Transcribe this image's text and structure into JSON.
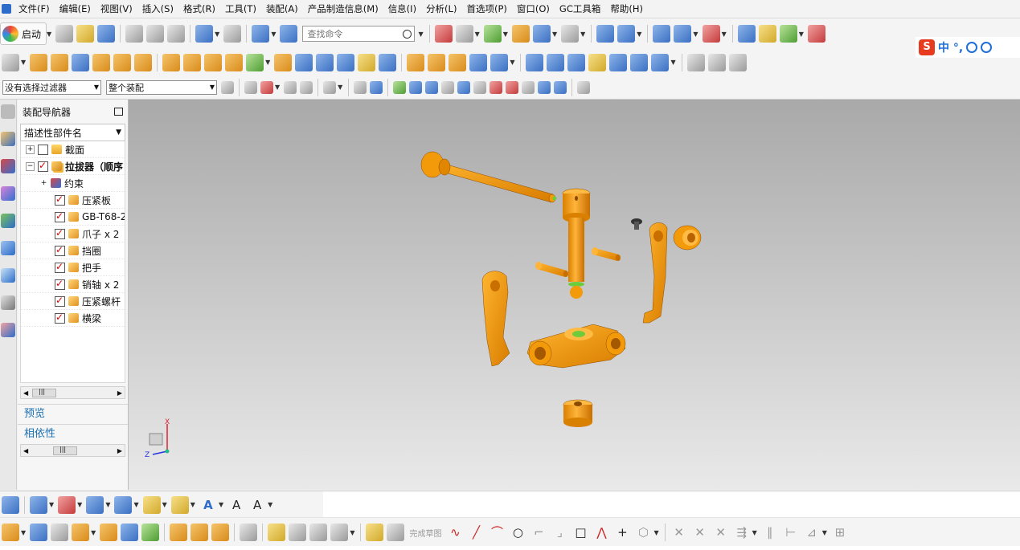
{
  "menubar": {
    "items": [
      "文件(F)",
      "编辑(E)",
      "视图(V)",
      "插入(S)",
      "格式(R)",
      "工具(T)",
      "装配(A)",
      "产品制造信息(M)",
      "信息(I)",
      "分析(L)",
      "首选项(P)",
      "窗口(O)",
      "GC工具箱",
      "帮助(H)"
    ]
  },
  "toolbar": {
    "launch_label": "启动",
    "search_placeholder": "查找命令"
  },
  "filters": {
    "selection_filter": "没有选择过滤器",
    "scope": "整个装配"
  },
  "ime": {
    "logo": "S",
    "text": "中 °,"
  },
  "navigator": {
    "title": "装配导航器",
    "column_header": "描述性部件名",
    "tree": [
      {
        "label": "截面",
        "checked": false,
        "expander": "+",
        "icon": "folder"
      },
      {
        "label": "拉拔器（顺序",
        "checked": true,
        "expander": "−",
        "icon": "assy"
      },
      {
        "label": "约束",
        "expander": "+",
        "icon": "constraint"
      },
      {
        "label": "压紧板",
        "checked": true,
        "icon": "part"
      },
      {
        "label": "GB-T68-2",
        "checked": true,
        "icon": "part"
      },
      {
        "label": "爪子 x 2",
        "checked": true,
        "icon": "part"
      },
      {
        "label": "挡圈",
        "checked": true,
        "icon": "part"
      },
      {
        "label": "把手",
        "checked": true,
        "icon": "part"
      },
      {
        "label": "销轴 x 2",
        "checked": true,
        "icon": "part"
      },
      {
        "label": "压紧螺杆",
        "checked": true,
        "icon": "part"
      },
      {
        "label": "横梁",
        "checked": true,
        "icon": "part"
      }
    ],
    "scroll_grip": "|||",
    "preview_label": "预览",
    "dependency_label": "相依性"
  },
  "viewport": {
    "triad_x": "X",
    "triad_z": "Z",
    "part_color": "#f39a0a",
    "background_top": "#a9a9a9",
    "background_bottom": "#e9e9e9"
  },
  "sketch_toolbar": {
    "finish_sketch": "完成草图"
  }
}
